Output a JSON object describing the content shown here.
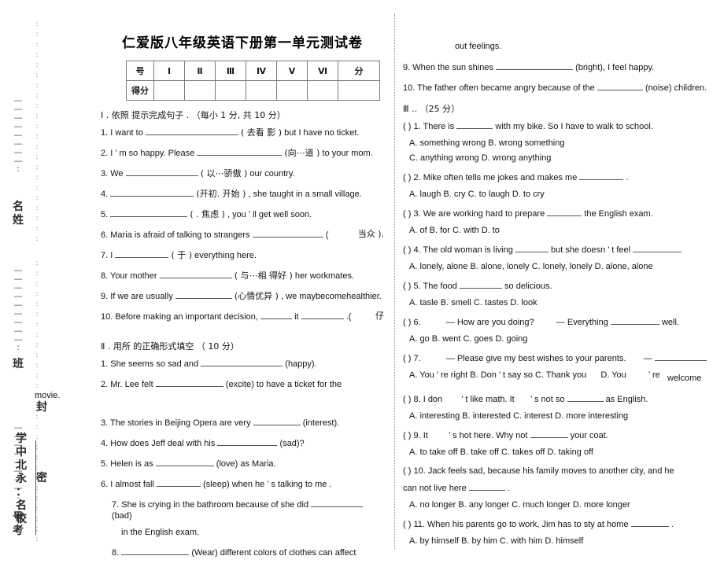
{
  "document": {
    "title": "仁爱版八年级英语下册第一单元测试卷"
  },
  "seal_margin": {
    "name_label": "姓 名",
    "class_label": "班",
    "seal_label": "封",
    "exam_number_label": "考 号",
    "secret_label": "密",
    "school_label": "校 名 ： 永 北 中 学",
    "school_chars": [
      "学",
      "中",
      "北",
      "永",
      "：",
      "名",
      "校"
    ],
    "name_chars": [
      "名",
      "姓"
    ],
    "exam_number_chars": [
      "号",
      "考"
    ],
    "dash": "—",
    "dot": "∶"
  },
  "score_table": {
    "row_header_1": "号",
    "row_header_2": "得分",
    "columns": [
      "Ⅰ",
      "Ⅱ",
      "Ⅲ",
      "Ⅳ",
      "Ⅴ",
      "Ⅵ"
    ],
    "total_header": "分",
    "scores": [
      "",
      "",
      "",
      "",
      "",
      "",
      ""
    ]
  },
  "section_1": {
    "heading": "Ⅰ . 依照   提示完成句子    . （每小  1 分, 共 10 分）",
    "questions": [
      {
        "num": "1.",
        "text_a": "I   want to",
        "hint": "( 去看  影 )",
        "text_b": "but     I have no ticket."
      },
      {
        "num": "2.",
        "text_a": "I ’ m so happy. Please",
        "hint": "(向⋯道  )",
        "text_b": "to your mom."
      },
      {
        "num": "3.",
        "text_a": "We",
        "hint": "( 以⋯骄傲 )",
        "text_b": "our country."
      },
      {
        "num": "4.",
        "text_a": "",
        "hint": "(开初.  开始 )",
        "text_b": ", she taught  in a small   village."
      },
      {
        "num": "5.",
        "text_a": "",
        "hint": "(    .   焦虑 )",
        "text_b": ", you ’  ll get well soon."
      },
      {
        "num": "6.",
        "text_a": "Maria is afraid of talking to strangers",
        "hint": "(",
        "text_b": "当众 )."
      },
      {
        "num": "7.",
        "text_a": "I",
        "hint": "(      于 )",
        "text_b": "everything here."
      },
      {
        "num": "8.",
        "text_a": "Your mother",
        "hint": "(  与⋯相  得好 )",
        "text_b": "her workmates."
      },
      {
        "num": "9.",
        "text_a": "If  we are usually",
        "hint": "(心情优异 )",
        "text_b": ", we maybecomehealthier."
      },
      {
        "num": "10.",
        "text_a": "Before making an important decision,",
        "hint": "it",
        "text_b": ".(",
        "tail": "仔"
      }
    ]
  },
  "section_2": {
    "heading": "Ⅱ . 用所   的正确形式填空 （ 10 分）",
    "questions": [
      {
        "num": "1.",
        "text_a": "She seems so sad and",
        "text_b": "(happy)."
      },
      {
        "num": "2.",
        "text_a": "Mr. Lee felt",
        "text_b": "(excite) to have a ticket for the"
      },
      {
        "num": "3.",
        "text_a": "The stories in Beijing Opera are very",
        "text_b": "(interest)."
      },
      {
        "num": "4.",
        "text_a": "How does Jeff deal with his",
        "text_b": "(sad)?"
      },
      {
        "num": "5.",
        "text_a": "Helen is as",
        "text_b": "(love) as Maria."
      },
      {
        "num": "6.",
        "text_a": "I almost fall",
        "text_b": "(sleep) when he            ’  s talking to me ."
      },
      {
        "num": "7.",
        "text_a": "She is  crying   in  the bathroom because of she did",
        "text_b": "(bad)",
        "text_c": "in the English exam."
      },
      {
        "num": "8.",
        "text_a": "",
        "text_b": "(Wear) different colors of clothes can affect",
        "text_c": "out feelings."
      },
      {
        "num": "9.",
        "text_a": "When the sun shines",
        "text_b": "(bright), I feel happy."
      },
      {
        "num": "10.",
        "text_a": "The father often became angry because of the",
        "text_b": "(noise) children."
      }
    ],
    "movie_fragment": "movie."
  },
  "section_3": {
    "heading": "Ⅲ .. （25 分）",
    "questions": [
      {
        "marker": "(      )",
        "num": "1.",
        "stem_a": "There is",
        "stem_b": "with my bike. So I have to walk to school.",
        "options_line_1": "A. something wrong            B. wrong something",
        "options_line_2": "C. anything wrong             D. wrong anything"
      },
      {
        "marker": "(      )",
        "num": "2.",
        "stem_a": "Mike often tells me jokes and makes me",
        "stem_b": ".",
        "options_line_1": "A. laugh    B. cry    C. to laugh     D. to cry"
      },
      {
        "marker": "(      )",
        "num": "3.",
        "stem_a": "We are working hard to prepare",
        "stem_b": "the English exam.",
        "options_line_1": "A. of      B. for     C. with     D. to"
      },
      {
        "marker": "(      )",
        "num": "4.",
        "stem_a": "The old woman is living",
        "stem_b": "but she doesn",
        "stem_c": "’  t feel",
        "options_line_1": "A. lonely, alone  B. alone, lonely     C. lonely, lonely  D. alone, alone"
      },
      {
        "marker": "(      )",
        "num": "5.",
        "stem_a": "The food",
        "stem_b": "so delicious.",
        "options_line_1": "A. tasle       B. smell     C. tastes      D. look"
      },
      {
        "marker": "(      )",
        "num": "6.",
        "stem_a": "— How are you doing?",
        "stem_b": "— Everything",
        "stem_c": "well.",
        "options_line_1": "A. go     B. went     C. goes    D. going"
      },
      {
        "marker": "(      )",
        "num": "7.",
        "stem_a": "— Please give my best wishes to your parents.",
        "stem_b": "—",
        "options_line_1": "A. You  ’  re right    B. Don            ’  t say so   C. Thank you",
        "options_line_2": "D. You",
        "answer_fragment_1": "’  re",
        "answer_fragment_2": "welcome"
      },
      {
        "marker": "(      )",
        "num": "8.",
        "stem_a": "I don",
        "stem_b": "’  t like math. It",
        "stem_c": "’  s not so",
        "stem_d": "as English.",
        "options_line_1": "A. interesting    B. interested   C. interest      D. more interesting"
      },
      {
        "marker": "(      )",
        "num": "9.",
        "stem_a": "It",
        "stem_b": "’  s hot here. Why not",
        "stem_c": "your coat.",
        "options_line_1": "A. to take off   B. take off    C. takes off     D. taking off"
      },
      {
        "marker": "(      )",
        "num": "10.",
        "stem_a": "Jack feels sad, because his family moves to another city, and he",
        "stem_b": "can not live here",
        "stem_c": ".",
        "options_line_1": "A. no longer    B. any longer   C. much longer  D. more longer"
      },
      {
        "marker": "(      )",
        "num": "11.",
        "stem_a": "When his parents go to work, Jim has to sty at home",
        "stem_b": ".",
        "options_line_1": "A. by himself   B. by him    C. with him      D. himself"
      }
    ]
  }
}
